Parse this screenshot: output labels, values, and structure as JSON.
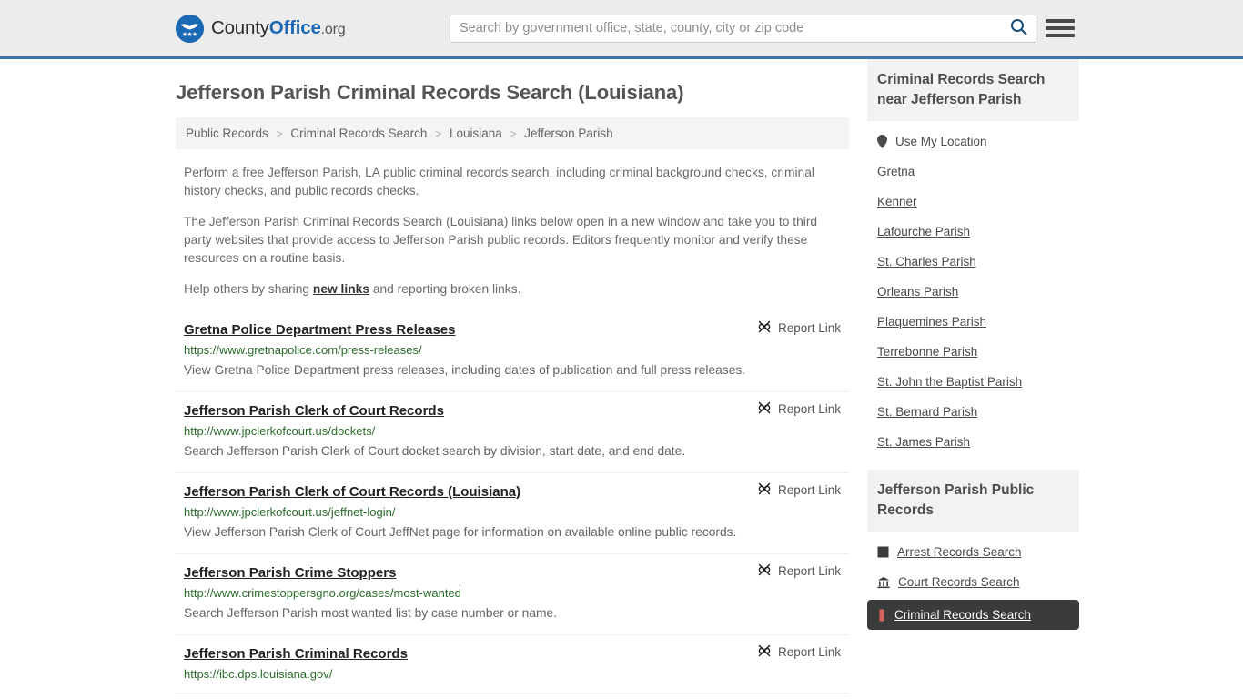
{
  "header": {
    "logo": {
      "part1": "County",
      "part2": "Office",
      "part3": ".org",
      "icon": "eagle-seal-icon"
    },
    "search": {
      "placeholder": "Search by government office, state, county, city or zip code",
      "value": "",
      "icon": "search-icon"
    },
    "menu_icon": "hamburger-menu-icon",
    "accent_color": "#3a74a8",
    "background_color": "#ececec"
  },
  "main": {
    "title": "Jefferson Parish Criminal Records Search (Louisiana)",
    "breadcrumb": [
      "Public Records",
      "Criminal Records Search",
      "Louisiana",
      "Jefferson Parish"
    ],
    "breadcrumb_separator": ">",
    "intro_1": "Perform a free Jefferson Parish, LA public criminal records search, including criminal background checks, criminal history checks, and public records checks.",
    "intro_2": "The Jefferson Parish Criminal Records Search (Louisiana) links below open in a new window and take you to third party websites that provide access to Jefferson Parish public records. Editors frequently monitor and verify these resources on a routine basis.",
    "intro_3_pre": "Help others by sharing ",
    "intro_3_link": "new links",
    "intro_3_post": " and reporting broken links.",
    "report_label": "Report Link",
    "report_icon": "broken-link-icon",
    "results": [
      {
        "title": "Gretna Police Department Press Releases",
        "url": "https://www.gretnapolice.com/press-releases/",
        "description": "View Gretna Police Department press releases, including dates of publication and full press releases."
      },
      {
        "title": "Jefferson Parish Clerk of Court Records",
        "url": "http://www.jpclerkofcourt.us/dockets/",
        "description": "Search Jefferson Parish Clerk of Court docket search by division, start date, and end date."
      },
      {
        "title": "Jefferson Parish Clerk of Court Records (Louisiana)",
        "url": "http://www.jpclerkofcourt.us/jeffnet-login/",
        "description": "View Jefferson Parish Clerk of Court JeffNet page for information on available online public records."
      },
      {
        "title": "Jefferson Parish Crime Stoppers",
        "url": "http://www.crimestoppersgno.org/cases/most-wanted",
        "description": "Search Jefferson Parish most wanted list by case number or name."
      },
      {
        "title": "Jefferson Parish Criminal Records",
        "url": "https://ibc.dps.louisiana.gov/",
        "description": ""
      }
    ]
  },
  "sidebar": {
    "nearby": {
      "heading": "Criminal Records Search near Jefferson Parish",
      "items": [
        {
          "label": "Use My Location",
          "icon": "map-pin-icon"
        },
        {
          "label": "Gretna",
          "icon": ""
        },
        {
          "label": "Kenner",
          "icon": ""
        },
        {
          "label": "Lafourche Parish",
          "icon": ""
        },
        {
          "label": "St. Charles Parish",
          "icon": ""
        },
        {
          "label": "Orleans Parish",
          "icon": ""
        },
        {
          "label": "Plaquemines Parish",
          "icon": ""
        },
        {
          "label": "Terrebonne Parish",
          "icon": ""
        },
        {
          "label": "St. John the Baptist Parish",
          "icon": ""
        },
        {
          "label": "St. Bernard Parish",
          "icon": ""
        },
        {
          "label": "St. James Parish",
          "icon": ""
        }
      ]
    },
    "public_records": {
      "heading": "Jefferson Parish Public Records",
      "items": [
        {
          "label": "Arrest Records Search",
          "icon": "fingerprint-icon",
          "active": false
        },
        {
          "label": "Court Records Search",
          "icon": "courthouse-icon",
          "active": false
        },
        {
          "label": "Criminal Records Search",
          "icon": "document-icon",
          "active": true
        }
      ],
      "active_background": "#3b3b3b"
    }
  }
}
